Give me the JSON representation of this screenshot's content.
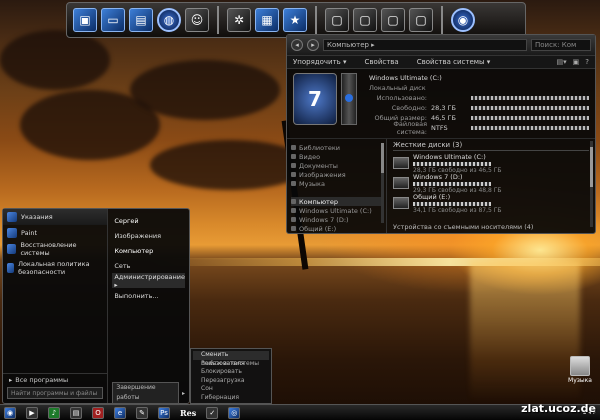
{
  "dock": {
    "icons": [
      "folder-icon",
      "monitor-icon",
      "computer-icon",
      "globe-icon",
      "user-icon",
      "gear-icon",
      "document-icon",
      "star-icon",
      "window-icon",
      "window-icon",
      "window-icon",
      "window-icon",
      "network-icon"
    ]
  },
  "explorer": {
    "address": "Компьютер ▸",
    "search_placeholder": "Поиск: Ком",
    "toolbar": {
      "organize": "Упорядочить ▾",
      "properties": "Свойства",
      "system_properties": "Свойства системы ▾"
    },
    "system": {
      "title": "Windows Ultimate (C:)",
      "subtitle": "Локальный диск",
      "rows": [
        {
          "label": "Использовано:",
          "value": ""
        },
        {
          "label": "Свободно:",
          "value": "28,3 ГБ"
        },
        {
          "label": "Общий размер:",
          "value": "46,5 ГБ"
        },
        {
          "label": "Файловая система:",
          "value": "NTFS"
        }
      ]
    },
    "nav": [
      {
        "label": "Библиотеки"
      },
      {
        "label": "Видео"
      },
      {
        "label": "Документы"
      },
      {
        "label": "Изображения"
      },
      {
        "label": "Музыка"
      },
      {
        "label": ""
      },
      {
        "label": "Компьютер"
      },
      {
        "label": "Windows Ultimate (C:)"
      },
      {
        "label": "Windows 7 (D:)"
      },
      {
        "label": "Общий (E:)"
      }
    ],
    "drives_header": "Жесткие диски (3)",
    "drives": [
      {
        "name": "Windows Ultimate (C:)",
        "free": "28,3 ГБ свободно из 46,5 ГБ"
      },
      {
        "name": "Windows 7 (D:)",
        "free": "29,3 ГБ свободно из 48,8 ГБ"
      },
      {
        "name": "Общий (E:)",
        "free": "34,1 ГБ свободно из 87,5 ГБ"
      }
    ],
    "removable_header": "Устройства со съемными носителями (4)"
  },
  "start_menu": {
    "pinned": [
      {
        "label": "Указания"
      },
      {
        "label": "Paint"
      },
      {
        "label": "Восстановление системы"
      },
      {
        "label": "Локальная политика безопасности"
      }
    ],
    "all_programs": "Все программы",
    "search_placeholder": "Найти программы и файлы",
    "right_links": [
      {
        "label": "Сергей"
      },
      {
        "label": "Изображения"
      },
      {
        "label": "Компьютер"
      },
      {
        "label": "Сеть"
      },
      {
        "label": "Администрирование ▸"
      },
      {
        "label": "Выполнить..."
      }
    ],
    "shutdown_label": "Завершение работы",
    "shutdown_arrow": "▸"
  },
  "submenu": {
    "items": [
      {
        "label": "Сменить пользователя"
      },
      {
        "label": "Выйти из системы"
      },
      {
        "label": "Блокировать"
      },
      {
        "label": "Перезагрузка"
      },
      {
        "label": "Сон"
      },
      {
        "label": "Гибернация"
      }
    ]
  },
  "desktop_icon": {
    "label": "Музыка"
  },
  "taskbar": {
    "clock": "▴ ◂ ▸",
    "app_text": "Res"
  },
  "watermark": "zlat.ucoz.de"
}
